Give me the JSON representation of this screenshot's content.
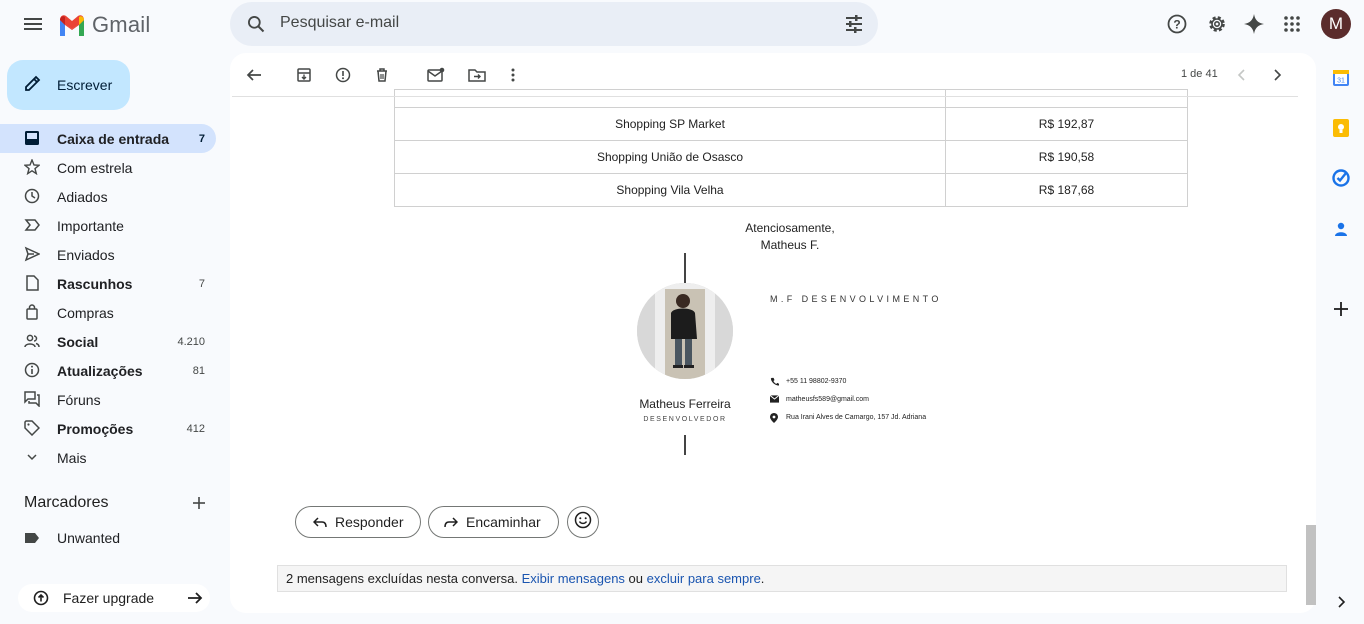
{
  "app": {
    "name": "Gmail"
  },
  "search": {
    "placeholder": "Pesquisar e-mail"
  },
  "user": {
    "avatar_letter": "M"
  },
  "compose": {
    "label": "Escrever"
  },
  "nav": [
    {
      "label": "Caixa de entrada",
      "count": "7",
      "icon": "inbox-icon",
      "bold": true,
      "active": true
    },
    {
      "label": "Com estrela",
      "count": "",
      "icon": "star-icon",
      "bold": false
    },
    {
      "label": "Adiados",
      "count": "",
      "icon": "clock-icon",
      "bold": false
    },
    {
      "label": "Importante",
      "count": "",
      "icon": "important-icon",
      "bold": false
    },
    {
      "label": "Enviados",
      "count": "",
      "icon": "send-icon",
      "bold": false
    },
    {
      "label": "Rascunhos",
      "count": "7",
      "icon": "draft-icon",
      "bold": true
    },
    {
      "label": "Compras",
      "count": "",
      "icon": "shopping-bag-icon",
      "bold": false
    },
    {
      "label": "Social",
      "count": "4.210",
      "icon": "people-icon",
      "bold": true
    },
    {
      "label": "Atualizações",
      "count": "81",
      "icon": "info-icon",
      "bold": true
    },
    {
      "label": "Fóruns",
      "count": "",
      "icon": "forum-icon",
      "bold": false
    },
    {
      "label": "Promoções",
      "count": "412",
      "icon": "tag-icon",
      "bold": true
    },
    {
      "label": "Mais",
      "count": "",
      "icon": "chevron-down-icon",
      "bold": false
    }
  ],
  "labels": {
    "heading": "Marcadores",
    "items": [
      {
        "label": "Unwanted"
      }
    ]
  },
  "upgrade": {
    "label": "Fazer upgrade"
  },
  "toolbar": {
    "pager": "1 de 41"
  },
  "email": {
    "table": [
      {
        "name": "Shopping SP Market",
        "value": "R$ 192,87"
      },
      {
        "name": "Shopping União de Osasco",
        "value": "R$ 190,58"
      },
      {
        "name": "Shopping Vila Velha",
        "value": "R$ 187,68"
      }
    ],
    "closing": "Atenciosamente,",
    "sender": "Matheus F.",
    "signature": {
      "name": "Matheus Ferreira",
      "role": "DESENVOLVEDOR",
      "company": "M.F DESENVOLVIMENTO",
      "phone": "+55 11 98802-9370",
      "email": "matheusfs589@gmail.com",
      "address": "Rua Irani Alves de Camargo, 157 Jd. Adriana"
    }
  },
  "actions": {
    "reply": "Responder",
    "forward": "Encaminhar"
  },
  "deleted_notice": {
    "text": "2 mensagens excluídas nesta conversa.",
    "show_link": "Exibir mensagens",
    "or": "ou",
    "delete_link": "excluir para sempre",
    "end": "."
  }
}
